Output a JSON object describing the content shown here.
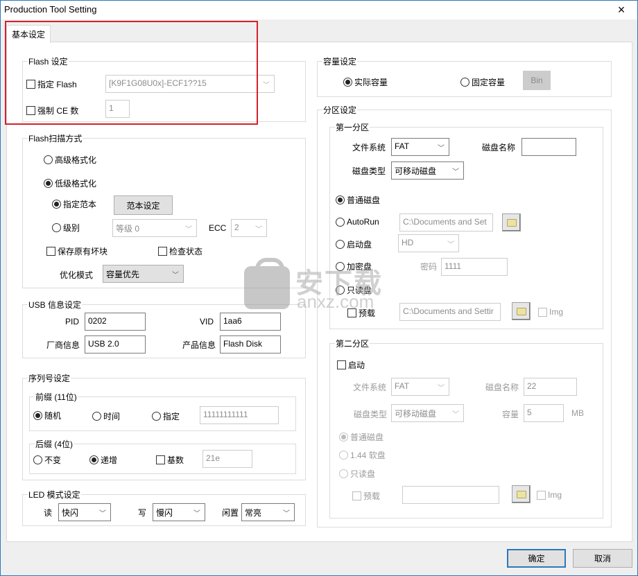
{
  "window": {
    "title": "Production Tool Setting",
    "close_icon": "×"
  },
  "tabs": [
    {
      "label": "基本设定",
      "active": true
    }
  ],
  "flash_settings": {
    "legend": "Flash 设定",
    "specify_flash": {
      "label": "指定 Flash",
      "checked": false,
      "value": "[K9F1G08U0x]-ECF1??15"
    },
    "force_ce": {
      "label": "强制 CE 数",
      "checked": false,
      "value": "1"
    }
  },
  "flash_scan": {
    "legend": "Flash扫描方式",
    "high_format": {
      "label": "高级格式化",
      "selected": false
    },
    "low_format": {
      "label": "低级格式化",
      "selected": true
    },
    "specify_template": {
      "label": "指定范本",
      "selected": true
    },
    "template_button": "范本设定",
    "level": {
      "label": "级别",
      "selected": false,
      "value": "等级 0"
    },
    "ecc": {
      "label": "ECC",
      "value": "2"
    },
    "keep_bad_blocks": {
      "label": "保存原有坏块",
      "checked": false
    },
    "check_status": {
      "label": "检查状态",
      "checked": false
    },
    "optimize": {
      "label": "优化模式",
      "value": "容量优先"
    }
  },
  "usb_info": {
    "legend": "USB 信息设定",
    "pid": {
      "label": "PID",
      "value": "0202"
    },
    "vid": {
      "label": "VID",
      "value": "1aa6"
    },
    "vendor": {
      "label": "厂商信息",
      "value": "USB 2.0"
    },
    "product": {
      "label": "产品信息",
      "value": "Flash Disk"
    }
  },
  "serial": {
    "legend": "序列号设定",
    "prefix": {
      "legend": "前缀 (11位)",
      "random": {
        "label": "随机",
        "selected": true
      },
      "time": {
        "label": "时间",
        "selected": false
      },
      "specify": {
        "label": "指定",
        "selected": false
      },
      "value": "11111111111"
    },
    "suffix": {
      "legend": "后缀 (4位)",
      "fixed": {
        "label": "不变",
        "selected": false
      },
      "increment": {
        "label": "递增",
        "selected": true
      },
      "base": {
        "label": "基数",
        "checked": false
      },
      "value": "21e"
    }
  },
  "led": {
    "legend": "LED 模式设定",
    "read": {
      "label": "读",
      "value": "快闪"
    },
    "write": {
      "label": "写",
      "value": "慢闪"
    },
    "idle": {
      "label": "闲置",
      "value": "常亮"
    }
  },
  "capacity": {
    "legend": "容量设定",
    "actual": {
      "label": "实际容量",
      "selected": true
    },
    "fixed": {
      "label": "固定容量",
      "selected": false
    },
    "bin_button": "Bin"
  },
  "partition": {
    "legend": "分区设定",
    "first": {
      "legend": "第一分区",
      "fs": {
        "label": "文件系统",
        "value": "FAT"
      },
      "disk_name": {
        "label": "磁盘名称",
        "value": ""
      },
      "disk_type": {
        "label": "磁盘类型",
        "value": "可移动磁盘"
      },
      "normal": {
        "label": "普通磁盘",
        "selected": true
      },
      "autorun": {
        "label": "AutoRun",
        "selected": false,
        "path": "C:\\Documents and Set"
      },
      "boot": {
        "label": "启动盘",
        "selected": false,
        "value": "HD"
      },
      "encrypted": {
        "label": "加密盘",
        "selected": false,
        "password_label": "密码",
        "password": "1111"
      },
      "readonly": {
        "label": "只读盘",
        "selected": false
      },
      "preload": {
        "label": "预载",
        "checked": false,
        "path": "C:\\Documents and Settir",
        "img_label": "Img",
        "img_checked": false
      }
    },
    "second": {
      "legend": "第二分区",
      "enable": {
        "label": "启动",
        "checked": false
      },
      "fs": {
        "label": "文件系统",
        "value": "FAT"
      },
      "disk_name": {
        "label": "磁盘名称",
        "value": "22"
      },
      "disk_type": {
        "label": "磁盘类型",
        "value": "可移动磁盘"
      },
      "size": {
        "label": "容量",
        "value": "5",
        "unit": "MB"
      },
      "normal": {
        "label": "普通磁盘",
        "selected": true
      },
      "floppy": {
        "label": "1.44 软盘",
        "selected": false
      },
      "readonly": {
        "label": "只读盘",
        "selected": false
      },
      "preload": {
        "label": "预载",
        "checked": false,
        "path": "",
        "img_label": "Img",
        "img_checked": false
      }
    }
  },
  "watermark": {
    "text": "安下载",
    "sub": "anxz.com"
  },
  "footer": {
    "ok": "确定",
    "cancel": "取消"
  },
  "colors": {
    "accent": "#2b79b8",
    "highlight_box": "#d3202a"
  }
}
